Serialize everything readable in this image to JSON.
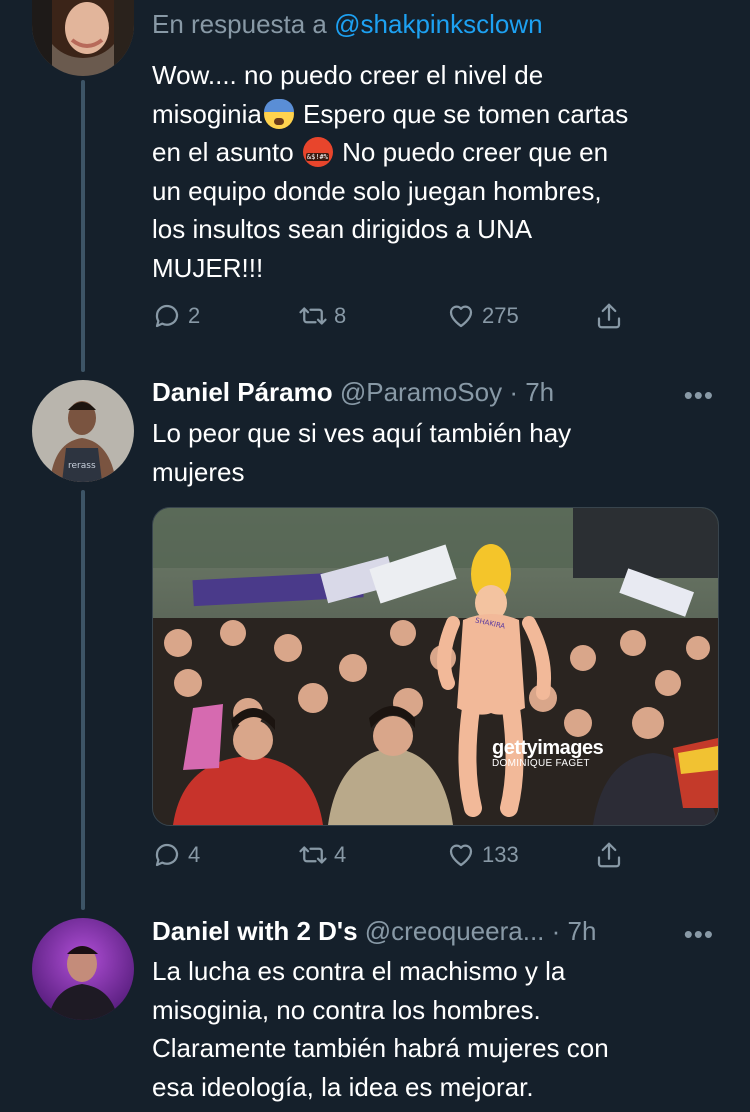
{
  "tweets": [
    {
      "reply_to_prefix": "En respuesta a ",
      "reply_to_handle": "@shakpinksclown",
      "text_parts": [
        "Wow.... no puedo creer el nivel de\nmisoginia",
        " Espero que se tomen cartas\nen el asunto ",
        " No puedo creer que en\nun equipo donde solo juegan hombres,\nlos insultos sean dirigidos a UNA\nMUJER!!!"
      ],
      "emojis": [
        "fearful-face-emoji",
        "face-with-symbols-emoji"
      ],
      "replies": "2",
      "retweets": "8",
      "likes": "275"
    },
    {
      "name": "Daniel Páramo",
      "handle_time": " @ParamoSoy · 7h",
      "text": "Lo peor que si ves aquí también hay\nmujeres",
      "media": {
        "watermark_brand": "gettyimages",
        "watermark_photographer": "DOMINIQUE FAGET",
        "doll_sash_text": "SHAKIRA"
      },
      "replies": "4",
      "retweets": "4",
      "likes": "133"
    },
    {
      "name": "Daniel with 2 D's",
      "handle_time": " @creoqueera... · 7h",
      "text": "La lucha es contra el machismo y la\nmisoginia, no contra los hombres.\nClaramente también habrá mujeres con\nesa ideología, la idea es mejorar."
    }
  ],
  "more_icon_text": "•••",
  "colors": {
    "background": "#15202b",
    "secondary_text": "#8899a6",
    "link": "#1da1f2",
    "thread_line": "#3d5466"
  }
}
